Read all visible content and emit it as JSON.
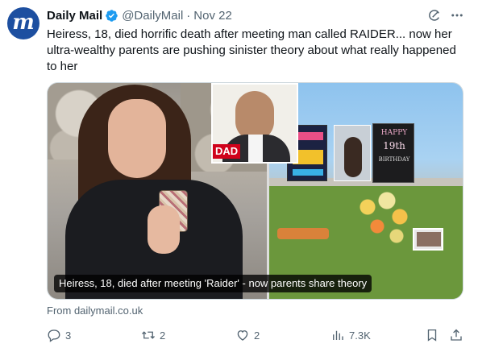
{
  "author": {
    "name": "Daily Mail",
    "handle": "@DailyMail",
    "date": "Nov 22",
    "avatar_letter": "m",
    "avatar_color": "#1d4fa0",
    "verified_color": "#1d9bf0"
  },
  "post": {
    "text": "Heiress, 18, died horrific death after meeting man called RAIDER... now her ultra-wealthy parents are pushing sinister theory about what really happened to her"
  },
  "media": {
    "caption": "Heiress, 18, died after meeting 'Raider' - now parents share theory",
    "inset_badge": "DAD",
    "badge_color": "#d0021b",
    "sign_line1": "HAPPY",
    "sign_line2": "19th",
    "sign_line3": "BIRTHDAY"
  },
  "link": {
    "source": "From dailymail.co.uk"
  },
  "actions": {
    "reply_count": "3",
    "repost_count": "2",
    "like_count": "2",
    "views_count": "7.3K"
  },
  "icons": [
    "verified-badge-icon",
    "grok-icon",
    "more-icon",
    "reply-icon",
    "repost-icon",
    "like-icon",
    "views-icon",
    "bookmark-icon",
    "share-icon"
  ]
}
